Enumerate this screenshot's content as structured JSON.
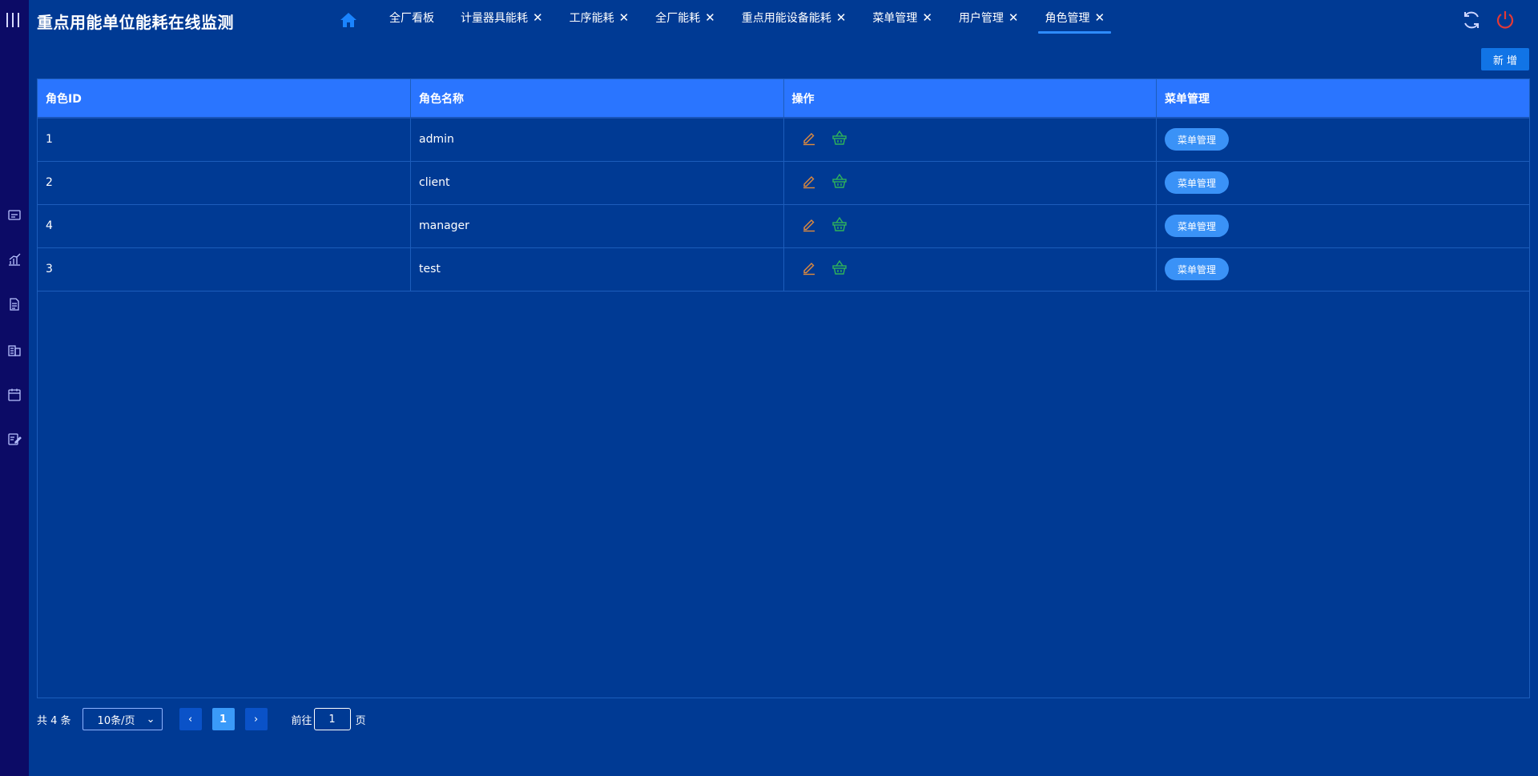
{
  "app": {
    "title": "重点用能单位能耗在线监测"
  },
  "tabs": [
    {
      "label": "全厂看板",
      "closable": false
    },
    {
      "label": "计量器具能耗",
      "closable": true
    },
    {
      "label": "工序能耗",
      "closable": true
    },
    {
      "label": "全厂能耗",
      "closable": true
    },
    {
      "label": "重点用能设备能耗",
      "closable": true
    },
    {
      "label": "菜单管理",
      "closable": true
    },
    {
      "label": "用户管理",
      "closable": true
    },
    {
      "label": "角色管理",
      "closable": true,
      "active": true
    }
  ],
  "toolbar": {
    "add_label": "新 增"
  },
  "table": {
    "columns": [
      "角色ID",
      "角色名称",
      "操作",
      "菜单管理"
    ],
    "rows": [
      {
        "id": "1",
        "name": "admin",
        "menu_button": "菜单管理"
      },
      {
        "id": "2",
        "name": "client",
        "menu_button": "菜单管理"
      },
      {
        "id": "4",
        "name": "manager",
        "menu_button": "菜单管理"
      },
      {
        "id": "3",
        "name": "test",
        "menu_button": "菜单管理"
      }
    ]
  },
  "pagination": {
    "total_label": "共 4 条",
    "page_size": "10条/页",
    "current_page": "1",
    "goto_prefix": "前往",
    "goto_value": "1",
    "goto_suffix": "页",
    "prev_icon": "chevron-left-icon",
    "next_icon": "chevron-right-icon"
  },
  "colors": {
    "page_bg": "#003a94",
    "sidebar_bg": "#0c0b66",
    "table_header_bg": "#2a75ff",
    "accent": "#2e8cff",
    "edit_icon": "#e08a3c",
    "delete_icon": "#2fb35a",
    "power_icon": "#e53935"
  },
  "icons": {
    "sidebar": [
      "menu-toggle-icon",
      "dashboard-icon",
      "bar-chart-icon",
      "document-icon",
      "building-icon",
      "calendar-icon",
      "edit-note-icon"
    ],
    "header_right": [
      "refresh-icon",
      "power-icon"
    ]
  }
}
